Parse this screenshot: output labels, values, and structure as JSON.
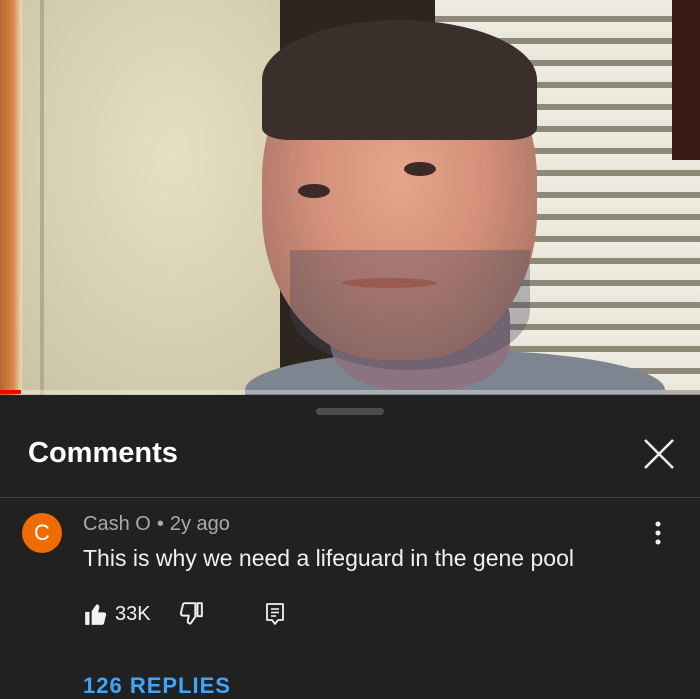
{
  "video": {
    "progress_fraction": 0.03
  },
  "comments_sheet": {
    "title": "Comments",
    "close_icon": "close-icon"
  },
  "comment": {
    "avatar_letter": "C",
    "avatar_color": "#ef6c00",
    "author": "Cash O",
    "separator": "•",
    "time": "2y ago",
    "text": "This is why we need a lifeguard in the gene pool",
    "like_count": "33K",
    "replies_label": "126 REPLIES"
  },
  "colors": {
    "background": "#212121",
    "accent_link": "#3ea6ff",
    "progress": "#ff0000"
  }
}
